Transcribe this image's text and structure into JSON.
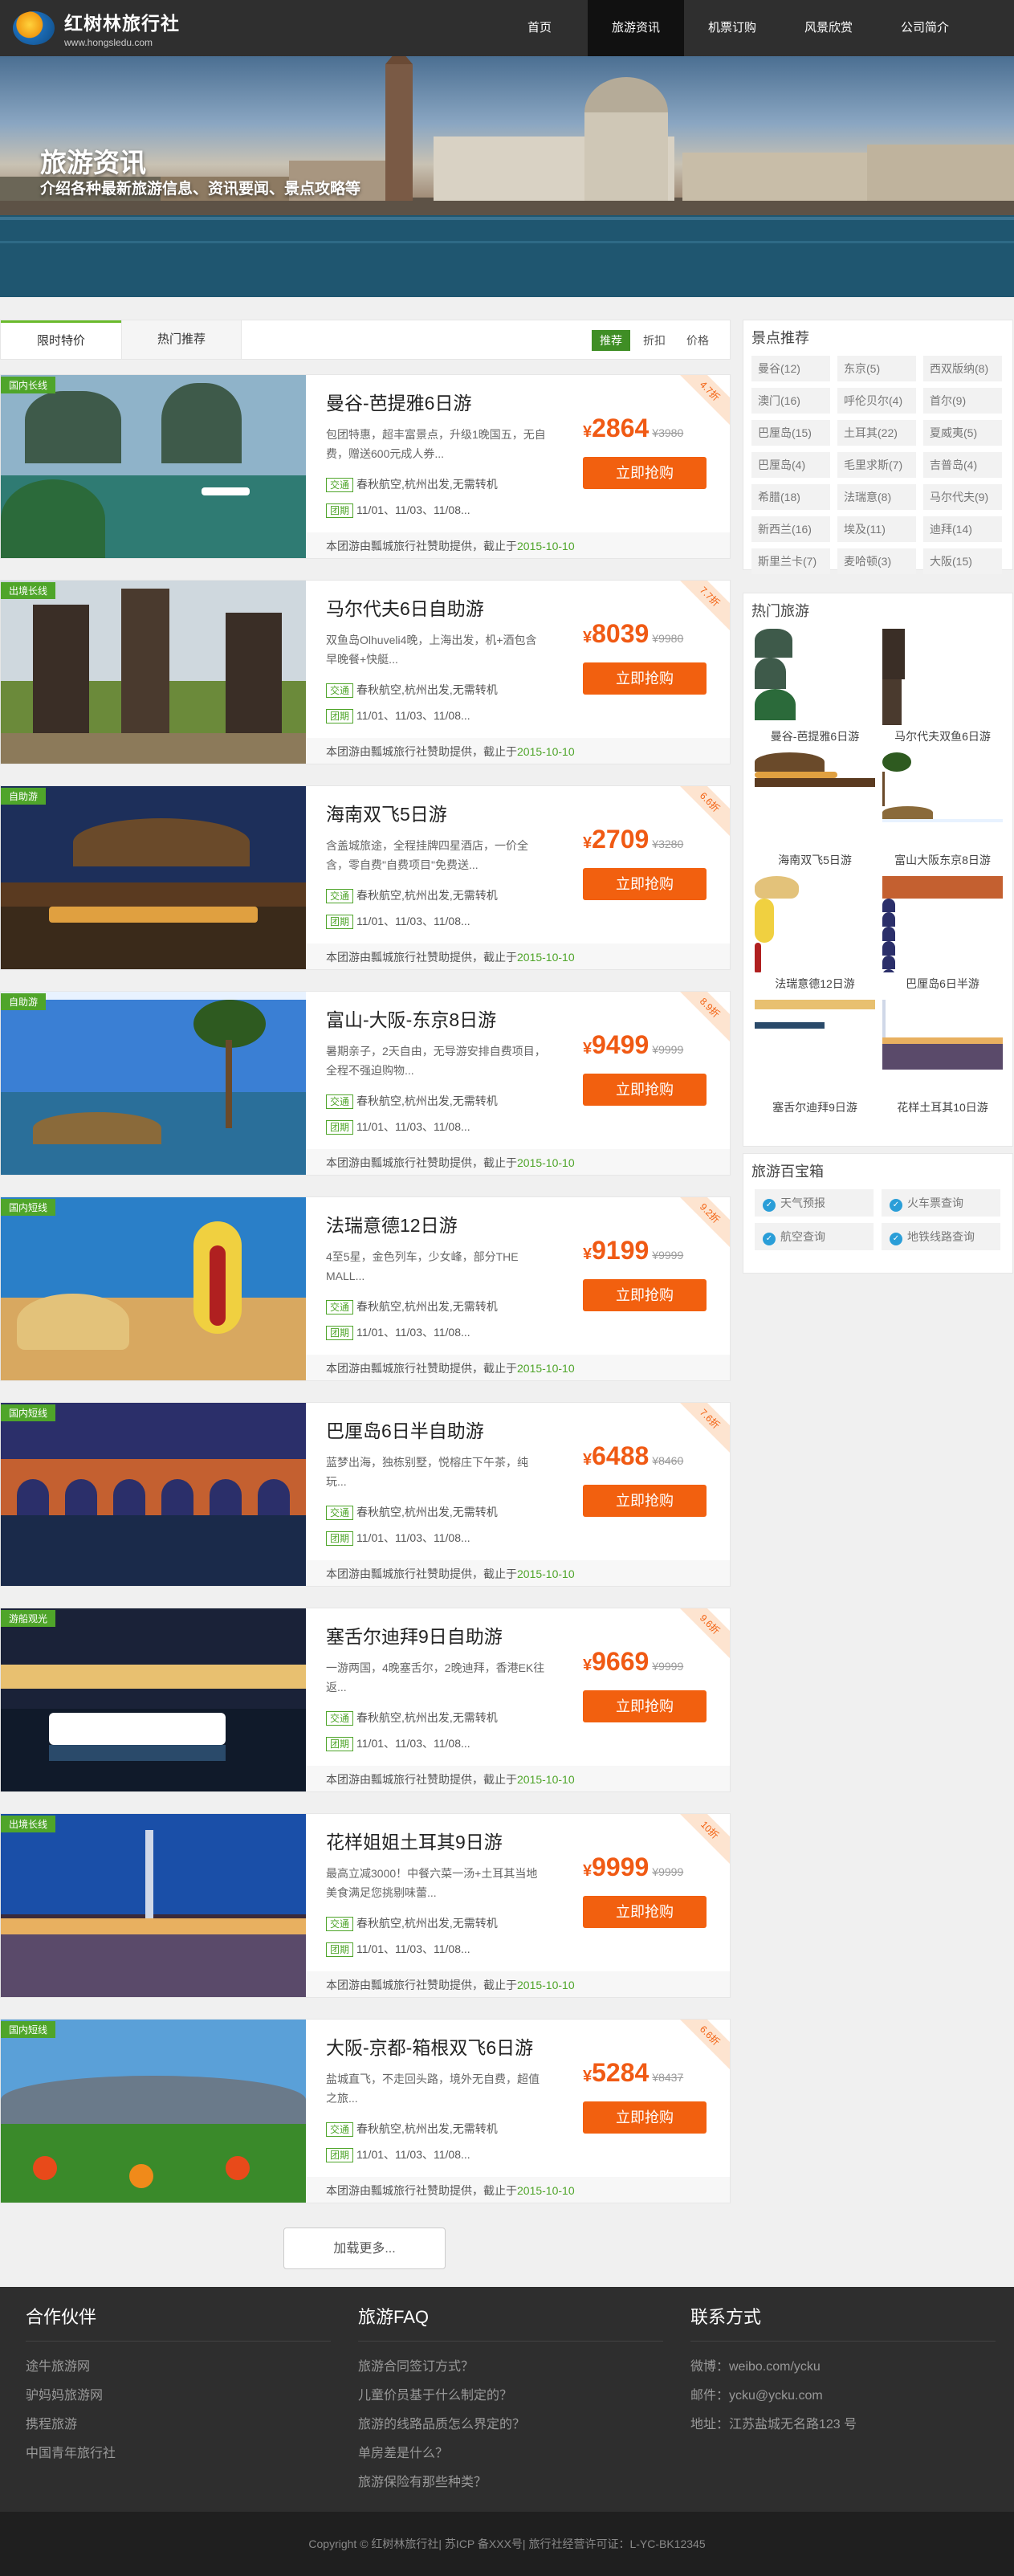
{
  "header": {
    "logo_cn": "红树林旅行社",
    "logo_url": "www.hongsledu.com",
    "nav": [
      {
        "label": "首页"
      },
      {
        "label": "旅游资讯"
      },
      {
        "label": "机票订购"
      },
      {
        "label": "风景欣赏"
      },
      {
        "label": "公司简介"
      }
    ]
  },
  "banner": {
    "title": "旅游资讯",
    "subtitle": "介绍各种最新旅游信息、资讯要闻、景点攻略等"
  },
  "tabs": {
    "items": [
      {
        "label": "限时特价"
      },
      {
        "label": "热门推荐"
      }
    ],
    "sorts": [
      {
        "label": "推荐"
      },
      {
        "label": "折扣"
      },
      {
        "label": "价格"
      }
    ]
  },
  "common": {
    "traffic_tag": "交通",
    "group_tag": "团期",
    "traffic": "春秋航空,杭州出发,无需转机",
    "buy": "立即抢购",
    "currency": "¥",
    "foot_text": "本团游由瓢城旅行社赞助提供，截止于",
    "foot_date": "2015-10-10"
  },
  "tours": [
    {
      "badge": "国内长线",
      "title": "曼谷-芭提雅6日游",
      "desc": "包团特惠，超丰富景点，升级1晚国五，无自费，赠送600元成人券...",
      "dates": "11/01、11/03、11/08...",
      "price": "2864",
      "old": "¥3980",
      "discount": "4.7折",
      "theme": "bay"
    },
    {
      "badge": "出境长线",
      "title": "马尔代夫6日自助游",
      "desc": "双鱼岛Olhuveli4晚，上海出发，机+酒包含 早晚餐+快艇...",
      "dates": "11/01、11/03、11/08...",
      "price": "8039",
      "old": "¥9980",
      "discount": "7.7折",
      "theme": "temple"
    },
    {
      "badge": "自助游",
      "title": "海南双飞5日游",
      "desc": "含盖城旅途，全程挂牌四星酒店，一价全含，零自费\"自费项目\"免费送...",
      "dates": "11/01、11/03、11/08...",
      "price": "2709",
      "old": "¥3280",
      "discount": "6.6折",
      "theme": "night"
    },
    {
      "badge": "自助游",
      "title": "富山-大阪-东京8日游",
      "desc": "暑期亲子，2天自由，无导游安排自费项目，全程不强迫购物...",
      "dates": "11/01、11/03、11/08...",
      "price": "9499",
      "old": "¥9999",
      "discount": "8.9折",
      "theme": "beach"
    },
    {
      "badge": "国内短线",
      "title": "法瑞意德12日游",
      "desc": "4至5星，金色列车，少女峰，部分THE MALL...",
      "dates": "11/01、11/03、11/08...",
      "price": "9199",
      "old": "¥9999",
      "discount": "9.2折",
      "theme": "sand"
    },
    {
      "badge": "国内短线",
      "title": "巴厘岛6日半自助游",
      "desc": "蓝梦出海，独栋别墅，悦榕庄下午茶，纯玩...",
      "dates": "11/01、11/03、11/08...",
      "price": "6488",
      "old": "¥8460",
      "discount": "7.6折",
      "theme": "bridge"
    },
    {
      "badge": "游船观光",
      "title": "塞舌尔迪拜9日自助游",
      "desc": "一游两国，4晚塞舌尔，2晚迪拜，香港EK往返...",
      "dates": "11/01、11/03、11/08...",
      "price": "9669",
      "old": "¥9999",
      "discount": "9.6折",
      "theme": "harbor"
    },
    {
      "badge": "出境长线",
      "title": "花样姐姐土耳其9日游",
      "desc": "最高立减3000！中餐六菜一汤+土耳其当地美食满足您挑剔味蕾...",
      "dates": "11/01、11/03、11/08...",
      "price": "9999",
      "old": "¥9999",
      "discount": "10折",
      "theme": "city"
    },
    {
      "badge": "国内短线",
      "title": "大阪-京都-箱根双飞6日游",
      "desc": "盐城直飞，不走回头路，境外无自费，超值之旅...",
      "dates": "11/01、11/03、11/08...",
      "price": "5284",
      "old": "¥8437",
      "discount": "6.6折",
      "theme": "flower"
    }
  ],
  "more": "加载更多...",
  "sidebar": {
    "spots_title": "景点推荐",
    "spots": [
      "曼谷(12)",
      "东京(5)",
      "西双版纳(8)",
      "澳门(16)",
      "呼伦贝尔(4)",
      "首尔(9)",
      "巴厘岛(15)",
      "土耳其(22)",
      "夏威夷(5)",
      "巴厘岛(4)",
      "毛里求斯(7)",
      "吉普岛(4)",
      "希腊(18)",
      "法瑞意(8)",
      "马尔代夫(9)",
      "新西兰(16)",
      "埃及(11)",
      "迪拜(14)",
      "斯里兰卡(7)",
      "麦哈顿(3)",
      "大阪(15)"
    ],
    "hot_title": "热门旅游",
    "hot": [
      {
        "label": "曼谷-芭提雅6日游",
        "theme": "bay"
      },
      {
        "label": "马尔代夫双鱼6日游",
        "theme": "temple"
      },
      {
        "label": "海南双飞5日游",
        "theme": "night"
      },
      {
        "label": "富山大阪东京8日游",
        "theme": "beach"
      },
      {
        "label": "法瑞意德12日游",
        "theme": "sand"
      },
      {
        "label": "巴厘岛6日半游",
        "theme": "bridge"
      },
      {
        "label": "塞舌尔迪拜9日游",
        "theme": "harbor"
      },
      {
        "label": "花样土耳其10日游",
        "theme": "city"
      }
    ],
    "tools_title": "旅游百宝箱",
    "tools": [
      {
        "label": "天气预报",
        "icon": "weather-icon"
      },
      {
        "label": "火车票查询",
        "icon": "train-icon"
      },
      {
        "label": "航空查询",
        "icon": "plane-icon"
      },
      {
        "label": "地铁线路查询",
        "icon": "subway-icon"
      }
    ]
  },
  "footer": {
    "partners_title": "合作伙伴",
    "partners": [
      "途牛旅游网",
      "驴妈妈旅游网",
      "携程旅游",
      "中国青年旅行社"
    ],
    "faq_title": "旅游FAQ",
    "faq": [
      "旅游合同签订方式？",
      "儿童价员基于什么制定的？",
      "旅游的线路品质怎么界定的？",
      "单房差是什么？",
      "旅游保险有那些种类？"
    ],
    "contact_title": "联系方式",
    "contact": [
      "微博：weibo.com/ycku",
      "邮件：ycku@ycku.com",
      "地址：江苏盐城无名路123 号"
    ],
    "copyright": "Copyright © 红树林旅行社| 苏ICP 备XXX号| 旅行社经营许可证：L-YC-BK12345"
  },
  "colors": {
    "accent": "#f2600f",
    "green": "#4fa52a",
    "dark": "#2f2f2f"
  }
}
